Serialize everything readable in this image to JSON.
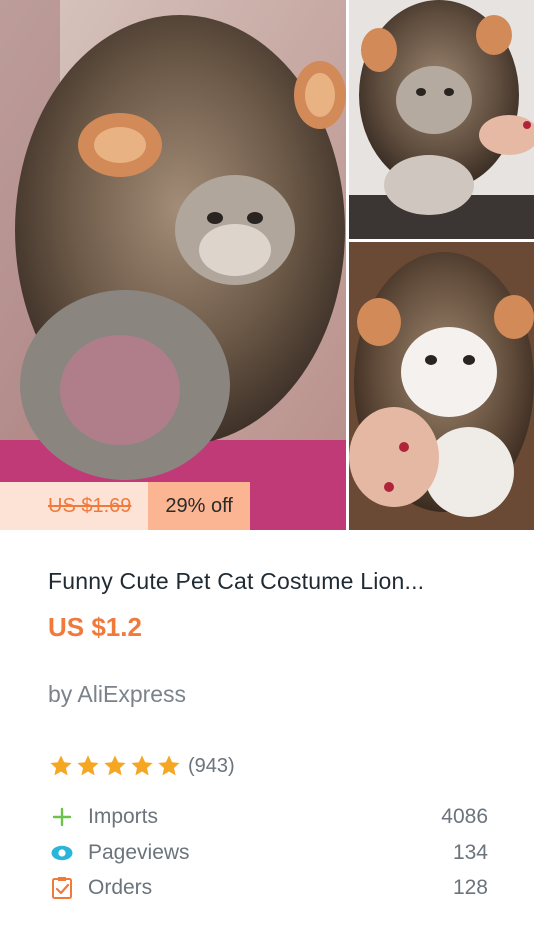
{
  "product": {
    "images": [
      {
        "alt": "cat in lion mane costume"
      },
      {
        "alt": "cat in lion mane costume held by hand"
      },
      {
        "alt": "white kitten in lion mane costume"
      }
    ],
    "original_price": "US $1.69",
    "discount": "29% off",
    "title": "Funny Cute Pet Cat Costume Lion...",
    "price": "US $1.2",
    "seller": "by AliExpress",
    "rating": {
      "stars": 5,
      "count": "(943)"
    },
    "stats": [
      {
        "icon": "plus-icon",
        "label": "Imports",
        "value": "4086"
      },
      {
        "icon": "eye-icon",
        "label": "Pageviews",
        "value": "134"
      },
      {
        "icon": "checklist-icon",
        "label": "Orders",
        "value": "128"
      }
    ]
  },
  "colors": {
    "accent_orange": "#f07a3c",
    "badge_light": "#fde3d6",
    "badge_dark": "#fbb593",
    "star": "#f5a623",
    "plus_green": "#6cc24a",
    "eye_blue": "#2bb5d8"
  }
}
